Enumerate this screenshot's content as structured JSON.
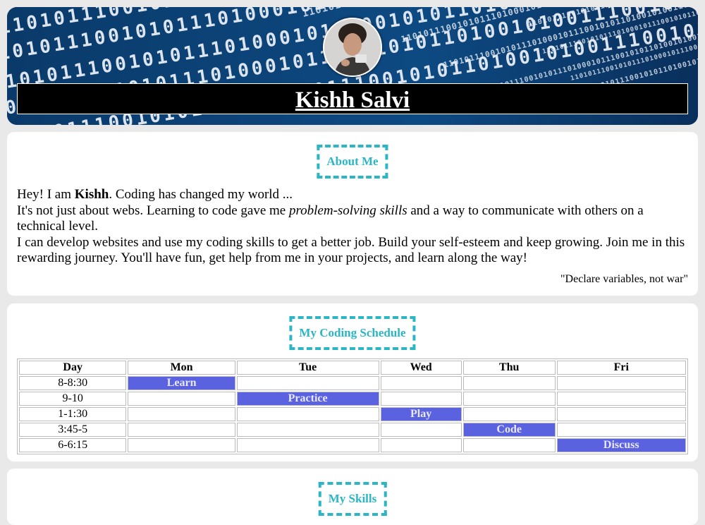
{
  "header": {
    "name": "Kishh Salvi",
    "background_binary_text": "1101011100101011101000101110010101101001010011100101100010111001"
  },
  "about": {
    "badge": "About Me",
    "line1_prefix": "Hey! I am ",
    "line1_bold": "Kishh",
    "line1_suffix": ". Coding has changed my world ...",
    "line2_prefix": "It's not just about webs. Learning to code gave me ",
    "line2_italic": "problem-solving skills",
    "line2_suffix": " and a way to communicate with others on a technical level.",
    "line3": "I can develop websites and use my coding skills to get a better job. Build your self-esteem and keep growing. Join me in this rewarding journey. You'll have fun, get help from me in your projects, and learn along the way!",
    "quote": "\"Declare variables, not war\""
  },
  "schedule": {
    "badge": "My Coding Schedule",
    "columns": [
      "Day",
      "Mon",
      "Tue",
      "Wed",
      "Thu",
      "Fri"
    ],
    "rows": [
      {
        "time": "8-8:30",
        "cells": [
          "Learn",
          "",
          "",
          "",
          ""
        ]
      },
      {
        "time": "9-10",
        "cells": [
          "",
          "Practice",
          "",
          "",
          ""
        ]
      },
      {
        "time": "1-1:30",
        "cells": [
          "",
          "",
          "Play",
          "",
          ""
        ]
      },
      {
        "time": "3:45-5",
        "cells": [
          "",
          "",
          "",
          "Code",
          ""
        ]
      },
      {
        "time": "6-6:15",
        "cells": [
          "",
          "",
          "",
          "",
          "Discuss"
        ]
      }
    ]
  },
  "skills": {
    "badge": "My Skills"
  },
  "colors": {
    "accent": "#2bb6c6",
    "highlight": "#5b62e0",
    "header_bg": "#0b3f73"
  }
}
